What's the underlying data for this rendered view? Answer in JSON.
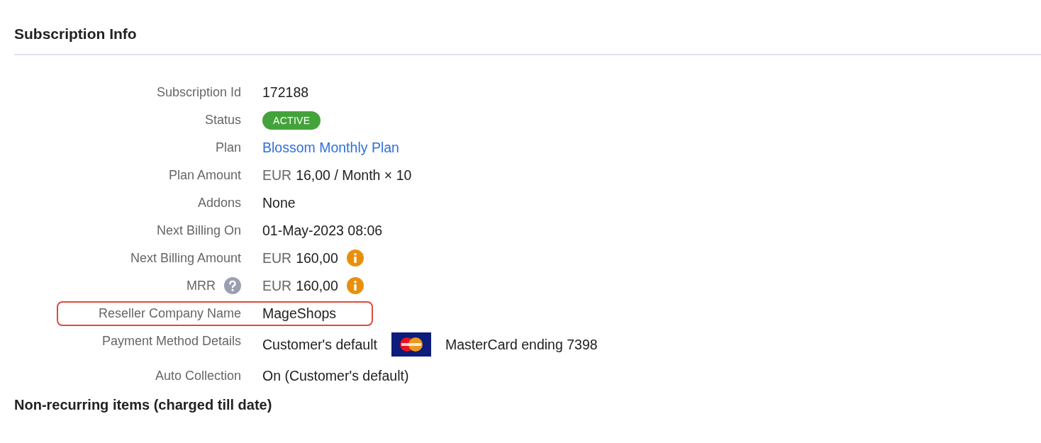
{
  "title": "Subscription Info",
  "rows": [
    {
      "label": "Subscription Id",
      "kind": "text",
      "value": "172188"
    },
    {
      "label": "Status",
      "kind": "badge",
      "value": "ACTIVE",
      "color": "#43a33a"
    },
    {
      "label": "Plan",
      "kind": "link",
      "value": "Blossom Monthly Plan"
    },
    {
      "label": "Plan Amount",
      "kind": "amount",
      "currency": "EUR",
      "value": "16,00 / Month × 10"
    },
    {
      "label": "Addons",
      "kind": "text",
      "value": "None"
    },
    {
      "label": "Next Billing On",
      "kind": "text",
      "value": "01-May-2023 08:06"
    },
    {
      "label": "Next Billing Amount",
      "kind": "amount",
      "currency": "EUR",
      "value": "160,00",
      "info": true
    },
    {
      "label": "MRR",
      "help": true,
      "kind": "amount",
      "currency": "EUR",
      "value": "160,00",
      "info": true
    },
    {
      "label": "Reseller Company Name",
      "kind": "text",
      "value": "MageShops",
      "highlighted": true
    },
    {
      "label": "Payment Method Details",
      "kind": "payment",
      "value": "Customer's default",
      "card": "MasterCard ending 7398"
    },
    {
      "label": "Auto Collection",
      "kind": "text",
      "value": "On (Customer's default)"
    }
  ],
  "next_section_title": "Non-recurring items (charged till date)"
}
